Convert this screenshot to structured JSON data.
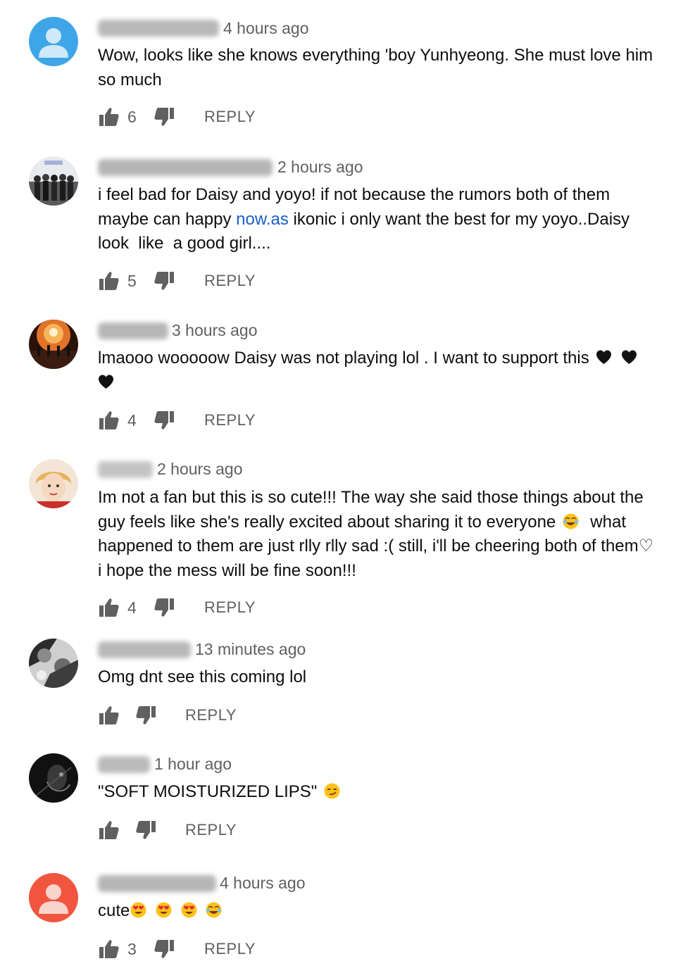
{
  "comments": [
    {
      "avatar": "default-user-avatar-blue",
      "time": "4 hours ago",
      "text": "Wow, looks like she knows everything 'boy Yunhyeong. She must love him\nso much",
      "likes": "6",
      "reply": "REPLY"
    },
    {
      "avatar": "group-photo-avatar",
      "time": "2 hours ago",
      "text_before_link": "i feel bad for Daisy and yoyo! if not because the rumors both of them\nmaybe can happy ",
      "link": "now.as",
      "text_after_link": " ikonic i only want the best for my yoyo..Daisy\nlook  like  a good girl....",
      "likes": "5",
      "reply": "REPLY"
    },
    {
      "avatar": "concert-photo-avatar",
      "time": "3 hours ago",
      "text": "lmaooo wooooow Daisy was not playing lol . I want to support this",
      "emoji": "black-heart",
      "likes": "4",
      "reply": "REPLY"
    },
    {
      "avatar": "selfie-photo-avatar",
      "time": "2 hours ago",
      "text_1": "Im not a fan but this is so cute!!! The way she said those things about the\nguy feels like she's really excited about sharing it to everyone",
      "emoji": "tears-of-joy",
      "text_2": "  what\nhappened to them are just rlly rlly sad :( still, i'll be cheering both of them♡\ni hope the mess will be fine soon!!!",
      "likes": "4",
      "reply": "REPLY"
    },
    {
      "avatar": "bw-photo-avatar",
      "time": "13 minutes ago",
      "text": "Omg dnt see this coming lol",
      "reply": "REPLY"
    },
    {
      "avatar": "dark-photo-avatar",
      "time": "1 hour ago",
      "text": "\"SOFT MOISTURIZED LIPS\"",
      "emoji": "smirking-face",
      "reply": "REPLY"
    },
    {
      "avatar": "default-user-avatar-red",
      "time": "4 hours ago",
      "text": "cute",
      "emojis": [
        "heart-eyes",
        "heart-eyes",
        "heart-eyes",
        "tears-of-joy"
      ],
      "likes": "3",
      "reply": "REPLY"
    }
  ],
  "icons": {
    "like": "thumbs-up-icon",
    "dislike": "thumbs-down-icon"
  },
  "colors": {
    "meta_text": "#606060",
    "link": "#1a5fc9",
    "default_avatar_blue": "#3ea6e8",
    "default_avatar_red": "#f2553f"
  }
}
